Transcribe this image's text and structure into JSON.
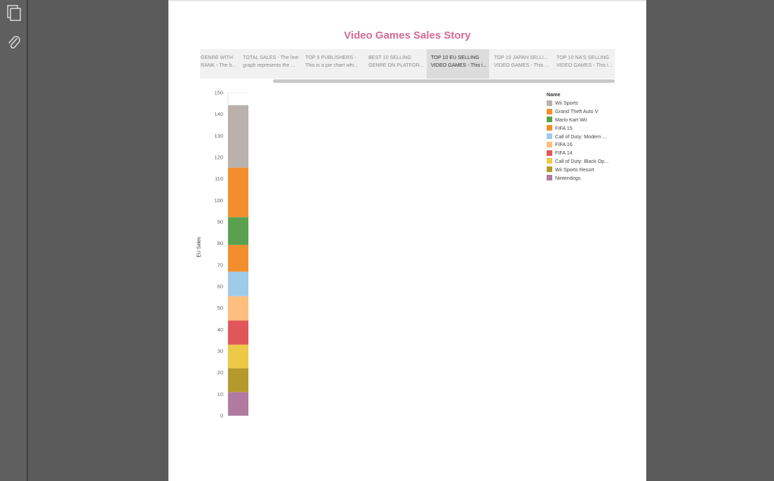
{
  "toolbar": {
    "icons": [
      "pages-icon",
      "attachment-icon"
    ]
  },
  "story": {
    "title": "Video Games Sales Story",
    "nav": [
      {
        "line1": "GENRE WITH",
        "line2": "RANK - The b..."
      },
      {
        "line1": "TOTAL SALES - The line",
        "line2": "graph represents the ..."
      },
      {
        "line1": "TOP 5 PUBLISHERS -",
        "line2": "This is a pie chart whi..."
      },
      {
        "line1": "BEST 10 SELLING",
        "line2": "GENRE ON PLATFOR..."
      },
      {
        "line1": "TOP 10 EU SELLING",
        "line2": "VIDEO GAMES - This i..."
      },
      {
        "line1": "TOP 10 JAPAN SELLING",
        "line2": "VIDEO GAMES - This b..."
      },
      {
        "line1": "TOP 10 NA'S SELLING",
        "line2": "VIDEO GAMES - This i..."
      }
    ],
    "active_index": 4
  },
  "chart_data": {
    "type": "bar",
    "stacked": true,
    "ylabel": "EU Sales",
    "ylim": [
      0,
      150
    ],
    "yticks": [
      0,
      10,
      20,
      30,
      40,
      50,
      60,
      70,
      80,
      90,
      100,
      110,
      120,
      130,
      140,
      150
    ],
    "legend_title": "Name",
    "legend_position": "right",
    "series": [
      {
        "name": "Wii Sports",
        "value": 29.0,
        "color": "#bab0ac"
      },
      {
        "name": "Grand Theft Auto V",
        "value": 23.0,
        "color": "#f28e2b"
      },
      {
        "name": "Mario Kart Wii",
        "value": 12.9,
        "color": "#59a14f"
      },
      {
        "name": "FIFA 15",
        "value": 12.4,
        "color": "#f28e2b"
      },
      {
        "name": "Call of Duty: Modern ...",
        "value": 11.4,
        "color": "#a0cbe8"
      },
      {
        "name": "FIFA 16",
        "value": 11.3,
        "color": "#ffbe7d"
      },
      {
        "name": "FIFA 14",
        "value": 11.2,
        "color": "#e15759"
      },
      {
        "name": "Call of Duty: Black Op...",
        "value": 11.0,
        "color": "#edc948"
      },
      {
        "name": "Wii Sports Resort",
        "value": 11.0,
        "color": "#b6992d"
      },
      {
        "name": "Nintendogs",
        "value": 11.0,
        "color": "#b07aa1"
      }
    ]
  }
}
